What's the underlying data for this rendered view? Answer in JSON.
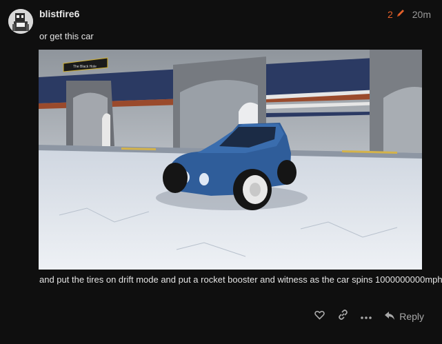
{
  "post": {
    "username": "blistfire6",
    "edit_count": "2",
    "time": "20m",
    "text_before_image": "or get this car",
    "image_sign_text": "The Black Hole",
    "text_after_image": "and put the tires on drift mode and put a rocket booster and witness as the car spins 1000000000mph"
  },
  "actions": {
    "like_icon": "heart-icon",
    "link_icon": "link-icon",
    "more_icon": "ellipsis-icon",
    "reply_label": "Reply"
  },
  "colors": {
    "background": "#0f0f0f",
    "accent": "#e5612a",
    "muted": "#9a9a9a"
  }
}
